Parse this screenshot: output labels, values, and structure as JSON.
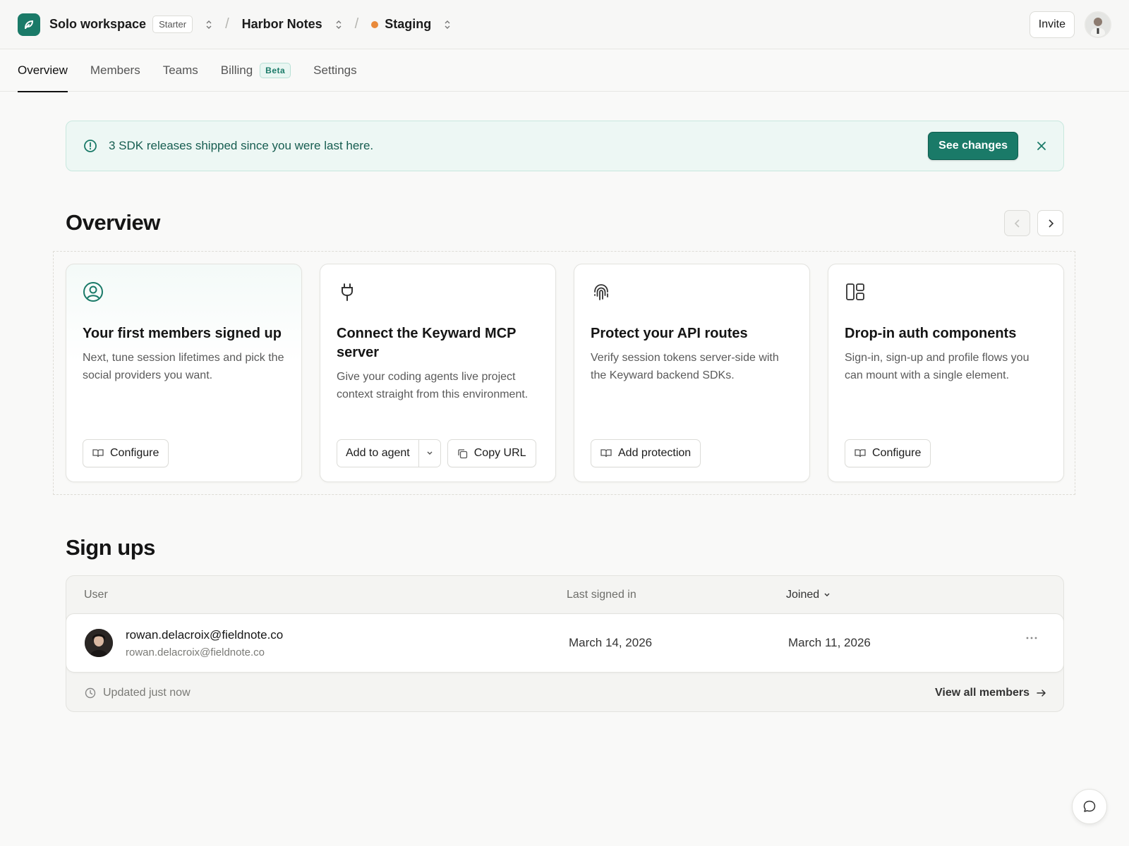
{
  "topbar": {
    "workspace_name": "Solo workspace",
    "plan": "Starter",
    "project": "Harbor Notes",
    "environment": "Staging",
    "environment_color": "#e98a3b",
    "invite_label": "Invite",
    "logo_icon": "leaf-logo-icon"
  },
  "tabs": [
    {
      "label": "Overview",
      "active": true
    },
    {
      "label": "Members"
    },
    {
      "label": "Teams"
    },
    {
      "label": "Billing",
      "badge": "Beta"
    },
    {
      "label": "Settings"
    }
  ],
  "banner": {
    "text": "3 SDK releases shipped since you were last here.",
    "action_label": "See changes",
    "accent": "#1a7a68"
  },
  "overview": {
    "title": "Overview",
    "cards": [
      {
        "icon": "user-circle-icon",
        "title": "Your first members signed up",
        "description": "Next, tune session lifetimes and pick the social providers you want.",
        "action": "Configure"
      },
      {
        "icon": "plug-icon",
        "title": "Connect the Keyward MCP server",
        "description": "Give your coding agents live project context straight from this environment.",
        "action": "Add to agent",
        "secondary_action": "Copy URL"
      },
      {
        "icon": "fingerprint-icon",
        "title": "Protect your API routes",
        "description": "Verify session tokens server-side with the Keyward backend SDKs.",
        "action": "Add protection"
      },
      {
        "icon": "layout-icon",
        "title": "Drop-in auth components",
        "description": "Sign-in, sign-up and profile flows you can mount with a single element.",
        "action": "Configure"
      }
    ]
  },
  "signups": {
    "title": "Sign ups",
    "columns": {
      "user": "User",
      "last_signed_in": "Last signed in",
      "joined": "Joined"
    },
    "rows": [
      {
        "name": "rowan.delacroix@fieldnote.co",
        "email": "rowan.delacroix@fieldnote.co",
        "last_signed_in": "March 14, 2026",
        "joined": "March 11, 2026"
      }
    ],
    "updated": "Updated just now",
    "view_all": "View all members"
  }
}
